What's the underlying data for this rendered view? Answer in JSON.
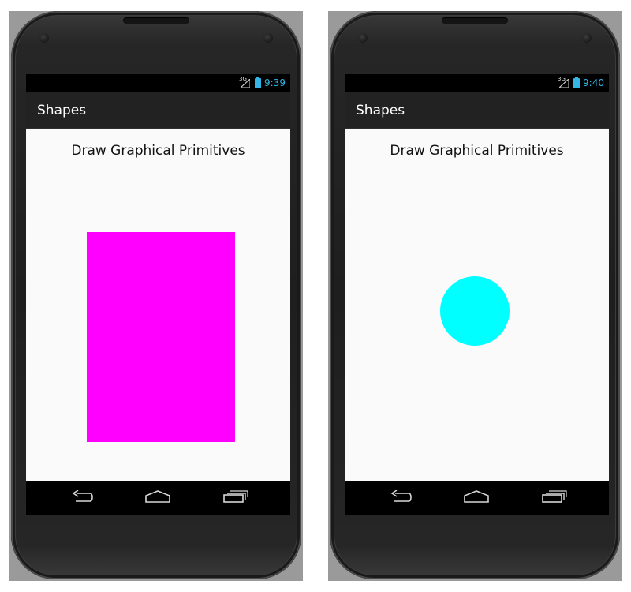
{
  "phones": [
    {
      "status": {
        "time": "9:39",
        "network": "3G"
      },
      "app_title": "Shapes",
      "heading": "Draw Graphical Primitives",
      "shape": {
        "kind": "rectangle",
        "color": "#ff00ff"
      }
    },
    {
      "status": {
        "time": "9:40",
        "network": "3G"
      },
      "app_title": "Shapes",
      "heading": "Draw Graphical Primitives",
      "shape": {
        "kind": "circle",
        "color": "#00ffff"
      }
    }
  ],
  "icons": {
    "back": "back-icon",
    "home": "home-icon",
    "recents": "recent-apps-icon",
    "signal": "signal-icon",
    "battery": "battery-charging-icon"
  },
  "colors": {
    "status_accent": "#33b5e5",
    "action_bar": "#222222",
    "content_bg": "#fafafa"
  }
}
